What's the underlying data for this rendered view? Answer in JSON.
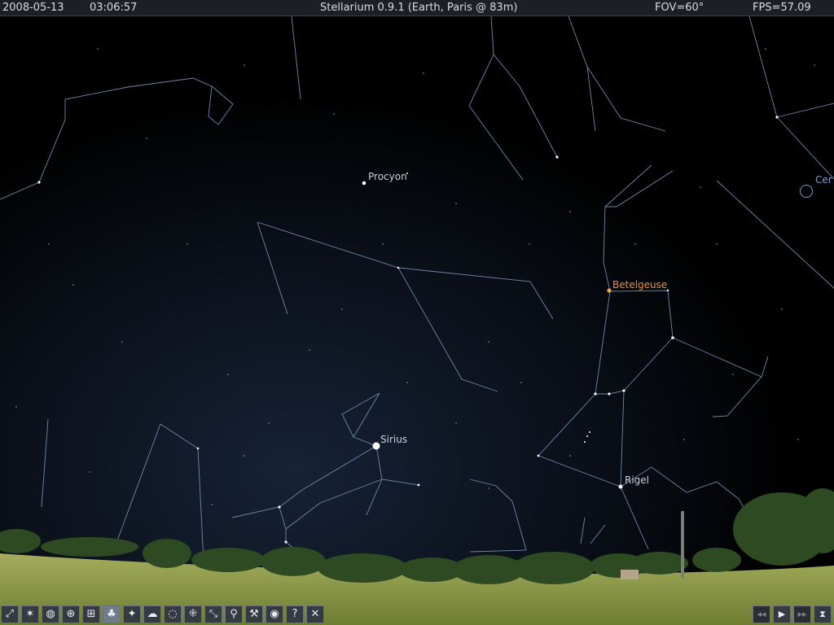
{
  "topbar": {
    "date": "2008-05-13",
    "time": "03:06:57",
    "location": "Stellarium 0.9.1 (Earth, Paris @ 83m)",
    "fov": "FOV=60°",
    "fps": "FPS=57.09"
  },
  "sky_labels": {
    "procyon": "Procyon",
    "betelgeuse": "Betelgeuse",
    "sirius": "Sirius",
    "rigel": "Rigel",
    "ceres": "Cer"
  },
  "colors": {
    "sky": "#000000",
    "constellation_line": "#6f88aa",
    "star_label": "#c7d2de",
    "betelgeuse_label": "#e8923a",
    "planet_label": "#7f9ccf",
    "grass": "#8a9a45",
    "trees": "#2d4a22",
    "toolbar_bg": "#353a42",
    "toolbar_active": "#6f7c8c"
  },
  "toolbar_left": [
    {
      "name": "constellation-lines-button",
      "glyph": "⤢"
    },
    {
      "name": "constellation-art-button",
      "glyph": "✶"
    },
    {
      "name": "constellation-labels-button",
      "glyph": "◍"
    },
    {
      "name": "equatorial-grid-button",
      "glyph": "⊕"
    },
    {
      "name": "azimuthal-grid-button",
      "glyph": "⊞"
    },
    {
      "name": "ground-button",
      "glyph": "♣"
    },
    {
      "name": "cardinal-points-button",
      "glyph": "✦"
    },
    {
      "name": "atmosphere-button",
      "glyph": "☁"
    },
    {
      "name": "nebulas-button",
      "glyph": "◌"
    },
    {
      "name": "planet-hints-button",
      "glyph": "⁜"
    },
    {
      "name": "equatorial-mount-button",
      "glyph": "⤡"
    },
    {
      "name": "search-button",
      "glyph": "⚲"
    },
    {
      "name": "configuration-button",
      "glyph": "⚒"
    },
    {
      "name": "night-mode-button",
      "glyph": "◉"
    },
    {
      "name": "help-button",
      "glyph": "?"
    },
    {
      "name": "quit-button",
      "glyph": "✕"
    }
  ],
  "toolbar_right": [
    {
      "name": "decrease-time-speed-button",
      "glyph": "◂◂"
    },
    {
      "name": "real-time-button",
      "glyph": "▶"
    },
    {
      "name": "increase-time-speed-button",
      "glyph": "▸▸"
    },
    {
      "name": "current-time-button",
      "glyph": "⧗"
    }
  ]
}
